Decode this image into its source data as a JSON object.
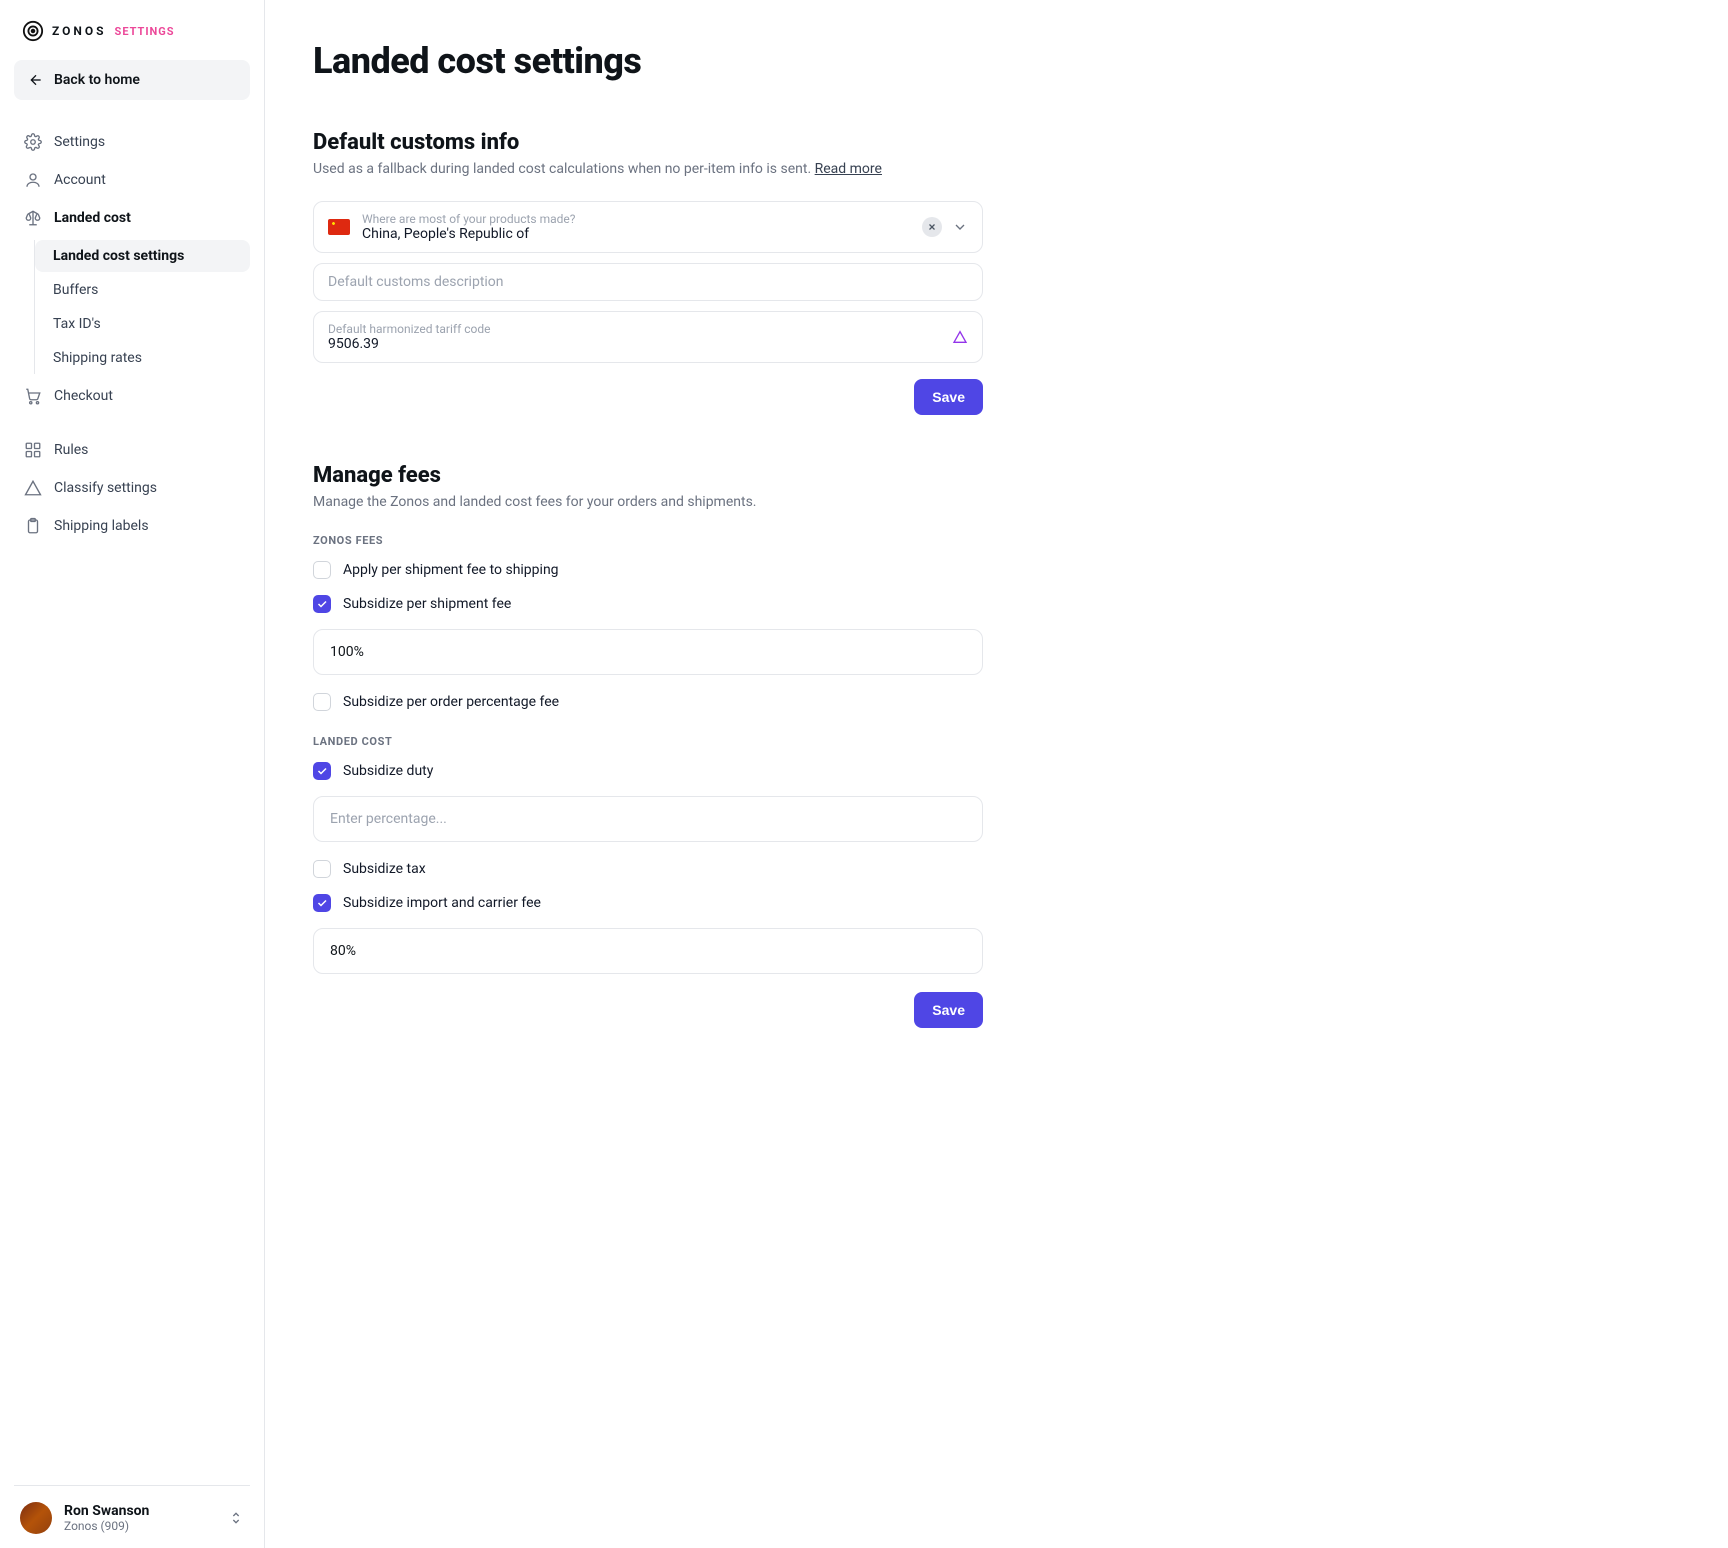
{
  "brand": {
    "name": "ZONOS",
    "badge": "SETTINGS"
  },
  "back": {
    "label": "Back to home"
  },
  "nav": {
    "settings": "Settings",
    "account": "Account",
    "landed_cost": "Landed cost",
    "landed_cost_settings": "Landed cost settings",
    "buffers": "Buffers",
    "tax_ids": "Tax ID's",
    "shipping_rates": "Shipping rates",
    "checkout": "Checkout",
    "rules": "Rules",
    "classify_settings": "Classify settings",
    "shipping_labels": "Shipping labels"
  },
  "user": {
    "name": "Ron Swanson",
    "org": "Zonos (909)"
  },
  "page": {
    "title": "Landed cost settings"
  },
  "customs": {
    "title": "Default customs info",
    "desc": "Used as a fallback during landed cost calculations when no per-item info is sent. ",
    "read_more": "Read more",
    "origin_label": "Where are most of your products made?",
    "origin_value": "China, People's Republic of",
    "desc_placeholder": "Default customs description",
    "hts_label": "Default harmonized tariff code",
    "hts_value": "9506.39",
    "save": "Save"
  },
  "fees": {
    "title": "Manage fees",
    "desc": "Manage the Zonos and landed cost fees for your orders and shipments.",
    "zonos_caps": "ZONOS FEES",
    "apply_shipment": "Apply per shipment fee to shipping",
    "subsidize_shipment": "Subsidize per shipment fee",
    "subsidize_shipment_value": "100%",
    "subsidize_order_pct": "Subsidize per order percentage fee",
    "landed_caps": "LANDED COST",
    "subsidize_duty": "Subsidize duty",
    "duty_placeholder": "Enter percentage...",
    "subsidize_tax": "Subsidize tax",
    "subsidize_import": "Subsidize import and carrier fee",
    "import_value": "80%",
    "save": "Save"
  }
}
